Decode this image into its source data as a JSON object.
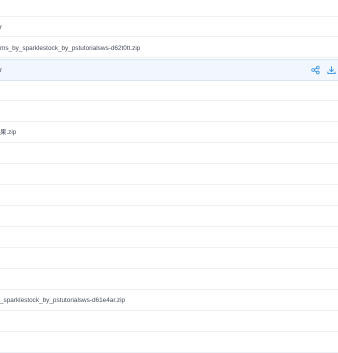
{
  "file_list": {
    "rows": [
      {
        "name": ""
      },
      {
        "name": "r"
      },
      {
        "name": "ms_by_sparklestock_by_pstutorialsws-d62t0tt.zip"
      },
      {
        "name": "r"
      },
      {
        "name": ""
      },
      {
        "name": ""
      },
      {
        "name": "果.zip"
      },
      {
        "name": ""
      },
      {
        "name": ""
      },
      {
        "name": ""
      },
      {
        "name": ""
      },
      {
        "name": ""
      },
      {
        "name": ""
      },
      {
        "name": ""
      },
      {
        "name": "_sparklestock_by_pstutorialsws-d61e4ar.zip"
      },
      {
        "name": ""
      },
      {
        "name": ""
      }
    ],
    "selected_row_index": 3,
    "selected_row_actions": [
      {
        "icon": "share-icon"
      },
      {
        "icon": "download-icon"
      }
    ],
    "accent_color": "#2f8fe0"
  }
}
